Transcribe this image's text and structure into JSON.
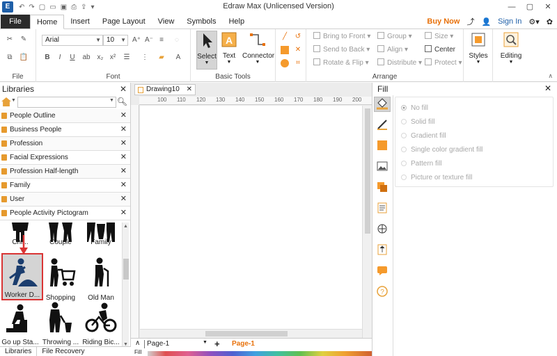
{
  "titlebar": {
    "app_title": "Edraw Max (Unlicensed Version)"
  },
  "menu": {
    "file": "File",
    "tabs": [
      "Home",
      "Insert",
      "Page Layout",
      "View",
      "Symbols",
      "Help"
    ],
    "buy_now": "Buy Now",
    "sign_in": "Sign In"
  },
  "ribbon": {
    "groups": {
      "file": "File",
      "font": "Font",
      "basic_tools": "Basic Tools",
      "arrange": "Arrange"
    },
    "font_name": "Arial",
    "font_size": "10",
    "tools": {
      "select": "Select",
      "text": "Text",
      "connector": "Connector",
      "styles": "Styles",
      "editing": "Editing"
    },
    "arrange": {
      "bring_front": "Bring to Front",
      "send_back": "Send to Back",
      "rotate_flip": "Rotate & Flip",
      "group": "Group",
      "align": "Align",
      "distribute": "Distribute",
      "size": "Size",
      "center": "Center",
      "protect": "Protect"
    }
  },
  "libraries": {
    "title": "Libraries",
    "categories": [
      "People Outline",
      "Business People",
      "Profession",
      "Facial Expressions",
      "Profession Half-length",
      "Family",
      "User",
      "People Activity Pictogram"
    ],
    "shapes": [
      "Chi...",
      "Couple",
      "Family",
      "Worker D...",
      "Shopping",
      "Old Man",
      "Go up Sta...",
      "Throwing ...",
      "Riding Bic..."
    ],
    "bottom_tabs": [
      "Libraries",
      "File Recovery"
    ]
  },
  "document": {
    "tab": "Drawing10",
    "ruler_ticks": [
      "100",
      "110",
      "120",
      "130",
      "140",
      "150",
      "160",
      "170",
      "180",
      "190",
      "200"
    ],
    "page_name": "Page-1",
    "active_page": "Page-1",
    "fill_label": "Fill"
  },
  "fill_panel": {
    "title": "Fill",
    "options": [
      "No fill",
      "Solid fill",
      "Gradient fill",
      "Single color gradient fill",
      "Pattern fill",
      "Picture or texture fill"
    ],
    "selected": "No fill"
  },
  "colors": {
    "accent": "#e8710a",
    "selected_outline": "#d93434",
    "library_icon": "#e69a2e"
  }
}
